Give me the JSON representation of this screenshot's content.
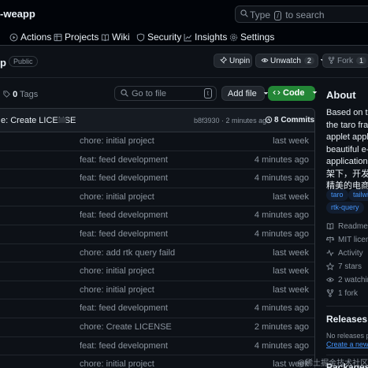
{
  "header": {
    "repo_title": "-weapp",
    "search_prefix": "Type",
    "search_key": "/",
    "search_suffix": "to search"
  },
  "nav": {
    "items": [
      {
        "label": "Actions",
        "icon": "play-icon"
      },
      {
        "label": "Projects",
        "icon": "table-icon"
      },
      {
        "label": "Wiki",
        "icon": "book-icon"
      },
      {
        "label": "Security",
        "icon": "shield-icon"
      },
      {
        "label": "Insights",
        "icon": "graph-icon"
      },
      {
        "label": "Settings",
        "icon": "gear-icon"
      }
    ]
  },
  "repo_bar": {
    "name_fragment": "p",
    "visibility": "Public",
    "unpin": "Unpin",
    "unwatch": "Unwatch",
    "watch_count": "2",
    "fork": "Fork",
    "fork_count": "1"
  },
  "file_nav": {
    "tags_count": "0",
    "tags_label": "Tags",
    "goto_placeholder": "Go to file",
    "goto_key": "t",
    "add_file": "Add file",
    "code": "Code"
  },
  "latest_commit": {
    "message": "e: Create LICENSE",
    "hash": "b8f3930",
    "time": "2 minutes ago",
    "commits": "8 Commits"
  },
  "files": [
    {
      "message": "chore: initial project",
      "time": "last week"
    },
    {
      "message": "feat: feed development",
      "time": "4 minutes ago"
    },
    {
      "message": "feat: feed development",
      "time": "4 minutes ago"
    },
    {
      "message": "chore: initial project",
      "time": "last week"
    },
    {
      "message": "feat: feed development",
      "time": "4 minutes ago"
    },
    {
      "message": "feat: feed development",
      "time": "4 minutes ago"
    },
    {
      "message": "chore: add rtk query faild",
      "time": "last week"
    },
    {
      "message": "chore: initial project",
      "time": "last week"
    },
    {
      "message": "chore: initial project",
      "time": "last week"
    },
    {
      "message": "feat: feed development",
      "time": "4 minutes ago"
    },
    {
      "message": "chore: Create LICENSE",
      "time": "2 minutes ago"
    },
    {
      "message": "feat: feed development",
      "time": "4 minutes ago"
    },
    {
      "message": "chore: initial project",
      "time": "last week"
    }
  ],
  "about": {
    "title": "About",
    "description_lines": [
      "Based on the",
      "the taro fram",
      "applet applic",
      "beautiful e-c",
      "application. 基",
      "架下，开发的",
      "精美的电商购"
    ],
    "topics": [
      "taro",
      "tailwi",
      "rtk-query"
    ],
    "meta": [
      {
        "label": "Readme",
        "icon": "book-icon"
      },
      {
        "label": "MIT licens",
        "icon": "law-icon"
      },
      {
        "label": "Activity",
        "icon": "pulse-icon"
      },
      {
        "label": "7 stars",
        "icon": "star-icon"
      },
      {
        "label": "2 watching",
        "icon": "eye-icon"
      },
      {
        "label": "1 fork",
        "icon": "fork-icon"
      }
    ]
  },
  "releases": {
    "title": "Releases",
    "none": "No releases publ",
    "create": "Create a new rele"
  },
  "packages": {
    "title": "Packages"
  },
  "watermark": "@稀土掘金技术社区"
}
